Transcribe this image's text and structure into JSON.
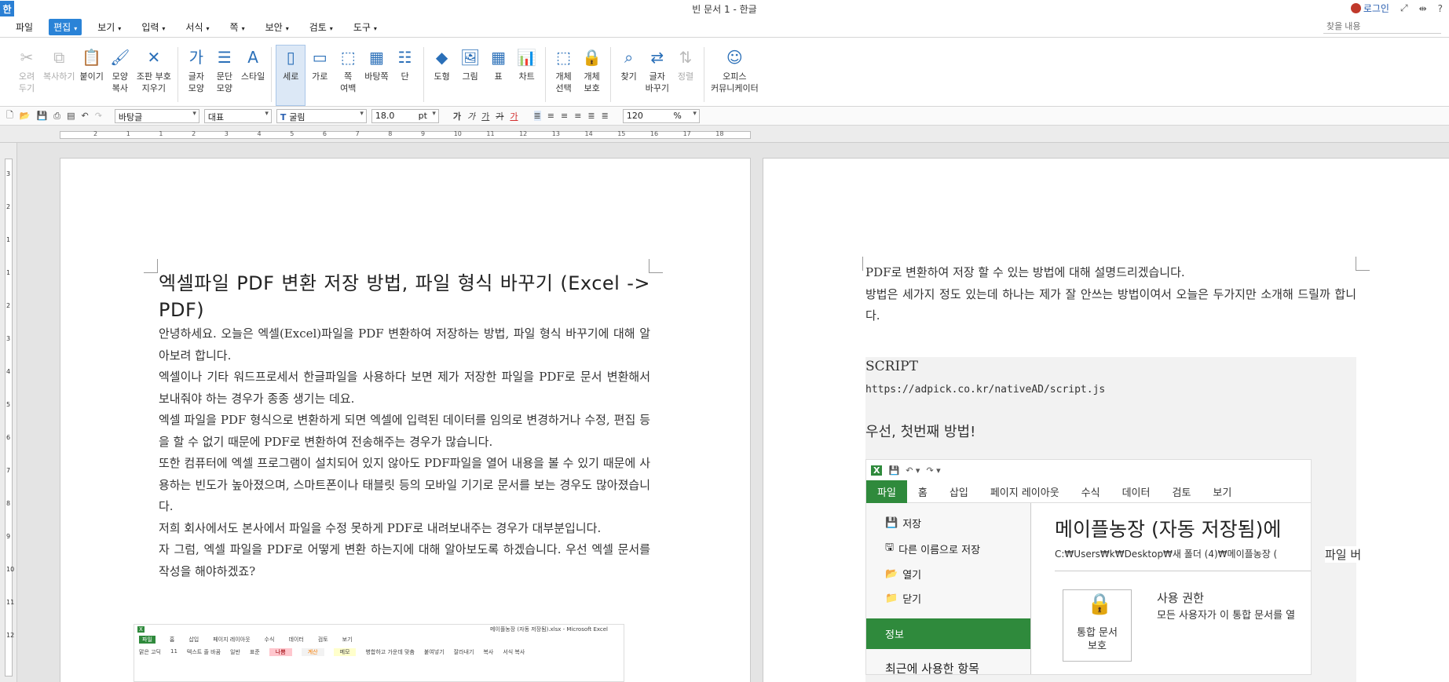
{
  "titlebar": {
    "logo": "한",
    "title": "빈 문서 1 - 한글",
    "login": "로그인"
  },
  "menubar": {
    "items": [
      {
        "label": "파일"
      },
      {
        "label": "편집"
      },
      {
        "label": "보기"
      },
      {
        "label": "입력"
      },
      {
        "label": "서식"
      },
      {
        "label": "쪽"
      },
      {
        "label": "보안"
      },
      {
        "label": "검토"
      },
      {
        "label": "도구"
      }
    ],
    "search_placeholder": "찾을 내용"
  },
  "ribbon": {
    "buttons": [
      {
        "label": "오려\n두기",
        "icon": "scissors-icon",
        "disabled": true
      },
      {
        "label": "복사하기",
        "icon": "copy-icon",
        "disabled": true
      },
      {
        "label": "붙이기",
        "icon": "paste-icon"
      },
      {
        "label": "모양\n복사",
        "icon": "format-painter-icon"
      },
      {
        "label": "조판 부호\n지우기",
        "icon": "erase-marks-icon"
      },
      {
        "label": "글자\n모양",
        "icon": "char-shape-icon"
      },
      {
        "label": "문단\n모양",
        "icon": "paragraph-shape-icon"
      },
      {
        "label": "스타일",
        "icon": "style-icon"
      },
      {
        "label": "세로",
        "icon": "portrait-icon",
        "selected": true
      },
      {
        "label": "가로",
        "icon": "landscape-icon"
      },
      {
        "label": "쪽\n여백",
        "icon": "page-margin-icon"
      },
      {
        "label": "바탕쪽",
        "icon": "master-page-icon"
      },
      {
        "label": "단",
        "icon": "columns-icon"
      },
      {
        "label": "도형",
        "icon": "shape-icon"
      },
      {
        "label": "그림",
        "icon": "picture-icon"
      },
      {
        "label": "표",
        "icon": "table-icon"
      },
      {
        "label": "차트",
        "icon": "chart-icon"
      },
      {
        "label": "개체\n선택",
        "icon": "object-select-icon"
      },
      {
        "label": "개체\n보호",
        "icon": "object-protect-icon"
      },
      {
        "label": "찾기",
        "icon": "binoculars-icon"
      },
      {
        "label": "글자\n바꾸기",
        "icon": "char-replace-icon"
      },
      {
        "label": "정렬",
        "icon": "sort-icon",
        "disabled": true
      },
      {
        "label": "오피스\n커뮤니케이터",
        "icon": "office-communicator-icon"
      }
    ]
  },
  "format": {
    "style": "바탕글",
    "lang": "대표",
    "font": "굴림",
    "size": "18.0",
    "unit": "pt",
    "zoom": "120",
    "zoom_unit": "%",
    "bold": "가",
    "italic": "가",
    "underline": "가",
    "strike": "가",
    "color": "가"
  },
  "ruler": {
    "ticks": [
      "2",
      "1",
      "1",
      "2",
      "3",
      "4",
      "5",
      "6",
      "7",
      "8",
      "9",
      "10",
      "11",
      "12",
      "13",
      "14",
      "15",
      "16",
      "17",
      "18"
    ],
    "vticks": [
      "3",
      "2",
      "1",
      "1",
      "2",
      "3",
      "4",
      "5",
      "6",
      "7",
      "8",
      "9",
      "10",
      "11",
      "12"
    ]
  },
  "page1": {
    "heading": "엑셀파일 PDF 변환 저장 방법, 파일 형식 바꾸기 (Excel -> PDF)",
    "paragraphs": [
      "안녕하세요. 오늘은 엑셀(Excel)파일을 PDF 변환하여 저장하는 방법, 파일 형식 바꾸기에 대해 알아보려 합니다.",
      "엑셀이나 기타 워드프로세서 한글파일을 사용하다 보면 제가 저장한 파일을 PDF로 문서 변환해서 보내줘야 하는 경우가 종종 생기는 데요.",
      "엑셀 파일을 PDF 형식으로 변환하게 되면 엑셀에 입력된 데이터를 임의로 변경하거나 수정, 편집 등을 할 수 없기 때문에 PDF로 변환하여 전송해주는 경우가 많습니다.",
      "또한 컴퓨터에 엑셀 프로그램이 설치되어 있지 않아도 PDF파일을 열어 내용을 볼 수 있기 때문에 사용하는 빈도가 높아졌으며, 스마트폰이나 태블릿 등의 모바일 기기로 문서를 보는 경우도 많아졌습니다.",
      "저희 회사에서도 본사에서 파일을 수정 못하게 PDF로 내려보내주는 경우가 대부분입니다.",
      "자 그럼, 엑셀 파일을 PDF로 어떻게 변환 하는지에 대해 알아보도록 하겠습니다. 우선 엑셀 문서를 작성을 해야하겠죠?"
    ],
    "mini_title": "메이플농장 (자동 저장됨).xlsx - Microsoft Excel",
    "mini_tabs": [
      "파일",
      "홈",
      "삽입",
      "페이지 레이아웃",
      "수식",
      "데이터",
      "검토",
      "보기"
    ],
    "mini_cells": [
      "맑은 고딕",
      "11",
      "텍스트 줄 바꿈",
      "일반",
      "표준",
      "나쁨",
      "계산",
      "메모",
      "병합하고 가운데 맞춤",
      "붙여넣기",
      "잘라내기",
      "복사",
      "서식 복사"
    ]
  },
  "page2": {
    "paragraphs": [
      "PDF로 변환하여 저장 할 수 있는 방법에 대해 설명드리겠습니다.",
      "방법은 세가지 정도 있는데 하나는 제가 잘 안쓰는 방법이여서 오늘은 두가지만 소개해 드릴까 합니다."
    ],
    "script_title": "SCRIPT",
    "script_url": "https://adpick.co.kr/nativeAD/script.js",
    "step_title": "우선, 첫번째 방법!",
    "excel": {
      "tabs": [
        "파일",
        "홈",
        "삽입",
        "페이지 레이아웃",
        "수식",
        "데이터",
        "검토",
        "보기"
      ],
      "side": [
        "저장",
        "다른 이름으로 저장",
        "열기",
        "닫기"
      ],
      "side_info": "정보",
      "side_recent": "최근에 사용한 항목",
      "heading": "메이플농장 (자동 저장됨)에",
      "path": "C:₩Users₩k₩Desktop₩새 폴더 (4)₩메이플농장 (",
      "perm_button": "통합 문서\n보호",
      "perm_title": "사용 권한",
      "perm_desc": "모든 사용자가 이 통합 문서를 열"
    },
    "trailing": "파일 버"
  },
  "colors": {
    "accent": "#2a83d7",
    "excel_green": "#2f8a3c",
    "canvas": "#e4e4e4"
  }
}
